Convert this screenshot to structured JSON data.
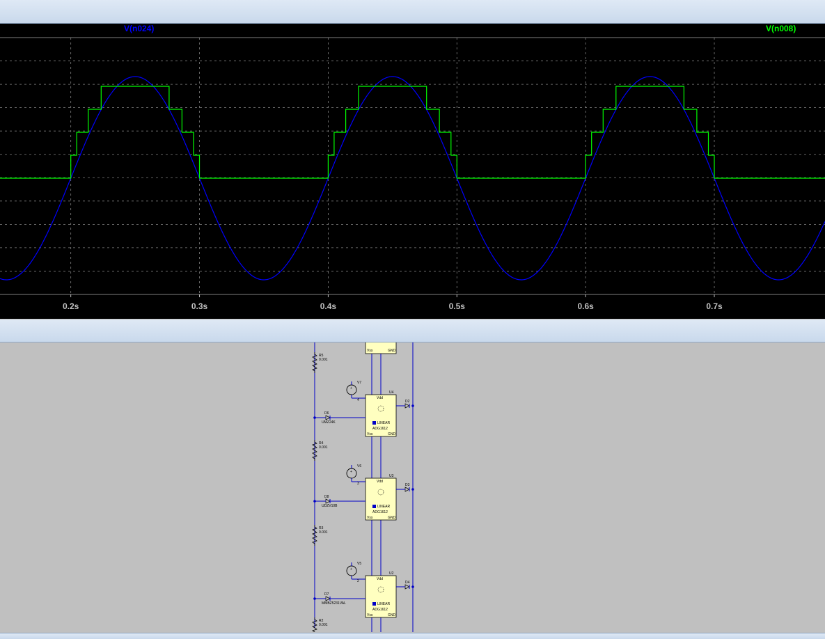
{
  "waveform": {
    "traces": [
      {
        "name": "V(n024)",
        "color": "#0000ff"
      },
      {
        "name": "V(n008)",
        "color": "#00ff00"
      }
    ],
    "x_ticks": [
      "0.2s",
      "0.3s",
      "0.4s",
      "0.5s",
      "0.6s",
      "0.7s"
    ]
  },
  "chart_data": {
    "type": "line",
    "xlabel": "",
    "ylabel": "",
    "xlim": [
      0.145,
      0.786
    ],
    "grid": true,
    "x_ticks": [
      0.2,
      0.3,
      0.4,
      0.5,
      0.6,
      0.7
    ],
    "series": [
      {
        "name": "V(n024)",
        "color": "#0000ff",
        "shape": "sine",
        "period": 0.2,
        "zero_crossing_rising": 0.2
      },
      {
        "name": "V(n008)",
        "color": "#00ff00",
        "shape": "staircase",
        "levels": [
          0,
          1,
          2,
          3,
          4
        ],
        "period": 0.2
      }
    ]
  },
  "schematic": {
    "resistors": [
      {
        "ref": "R5",
        "value": "0.001"
      },
      {
        "ref": "R4",
        "value": "0.001"
      },
      {
        "ref": "R3",
        "value": "0.001"
      },
      {
        "ref": "R2",
        "value": "0.001"
      }
    ],
    "sources": [
      {
        "ref": "V7",
        "value": "4"
      },
      {
        "ref": "V6",
        "value": "3"
      },
      {
        "ref": "V5",
        "value": "2"
      }
    ],
    "zeners": [
      {
        "ref": "D6",
        "part": "UMZ24K"
      },
      {
        "ref": "D8",
        "part": "UDZV10B"
      },
      {
        "ref": "D7",
        "part": "MMBZ5231VAL"
      }
    ],
    "switches": [
      {
        "ref": "U4",
        "part": "ADG1612"
      },
      {
        "ref": "U3",
        "part": "ADG1612"
      },
      {
        "ref": "U2",
        "part": "ADG1612"
      }
    ],
    "out_diodes": [
      "D2",
      "D3",
      "D4"
    ],
    "pins": {
      "vdd": "Vdd",
      "vss": "Vss",
      "gnd": "GND",
      "brand": "LINEAR"
    }
  }
}
